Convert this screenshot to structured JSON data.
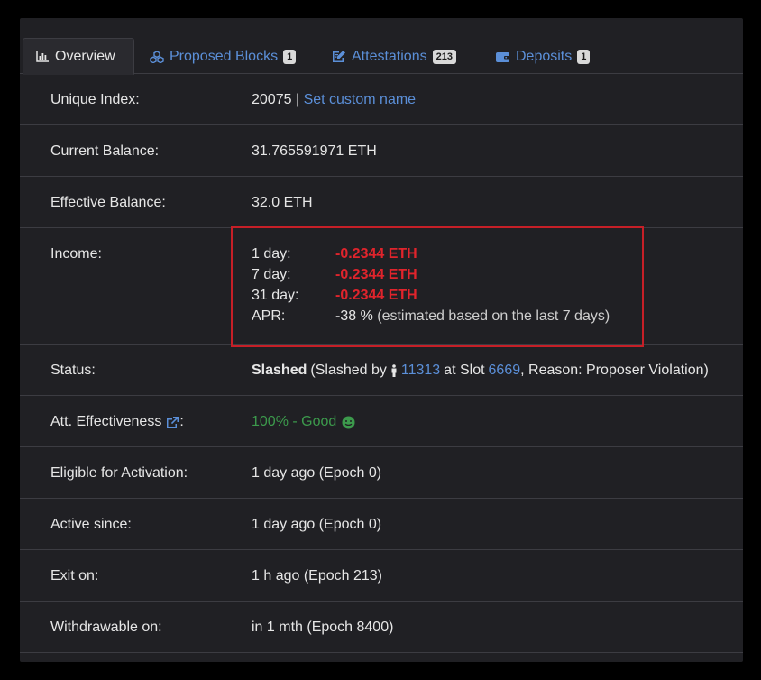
{
  "tabs": [
    {
      "label": "Overview",
      "icon": "bar-chart-icon",
      "active": true
    },
    {
      "label": "Proposed Blocks",
      "icon": "cubes-icon",
      "badge": "1"
    },
    {
      "label": "Attestations",
      "icon": "edit-icon",
      "badge": "213"
    },
    {
      "label": "Deposits",
      "icon": "wallet-icon",
      "badge": "1"
    }
  ],
  "rows": {
    "unique_index": {
      "label": "Unique Index:",
      "value": "20075",
      "separator": "|",
      "link": "Set custom name"
    },
    "current_balance": {
      "label": "Current Balance:",
      "value": "31.765591971 ETH"
    },
    "effective_balance": {
      "label": "Effective Balance:",
      "value": "32.0 ETH"
    },
    "income": {
      "label": "Income:",
      "items": [
        {
          "period": "1 day:",
          "amount": "-0.2344 ETH"
        },
        {
          "period": "7 day:",
          "amount": "-0.2344 ETH"
        },
        {
          "period": "31 day:",
          "amount": "-0.2344 ETH"
        }
      ],
      "apr_label": "APR:",
      "apr_value": "-38 %",
      "apr_note": "(estimated based on the last 7 days)"
    },
    "status": {
      "label": "Status:",
      "state": "Slashed",
      "prefix": "(Slashed by",
      "slasher": "11313",
      "at_slot": "at Slot",
      "slot": "6669",
      "reason": ", Reason: Proposer Violation)"
    },
    "att_effectiveness": {
      "label": "Att. Effectiveness",
      "suffix": ":",
      "value": "100% - Good"
    },
    "eligible": {
      "label": "Eligible for Activation:",
      "value": "1 day ago (Epoch 0)"
    },
    "active_since": {
      "label": "Active since:",
      "value": "1 day ago (Epoch 0)"
    },
    "exit_on": {
      "label": "Exit on:",
      "value": "1 h ago (Epoch 213)"
    },
    "withdrawable": {
      "label": "Withdrawable on:",
      "value": "in 1 mth (Epoch 8400)"
    }
  },
  "colors": {
    "link": "#5b8fd8",
    "negative": "#e0242c",
    "good": "#3c9a4c",
    "highlight_border": "#c61f27",
    "panel_bg": "#202024"
  }
}
